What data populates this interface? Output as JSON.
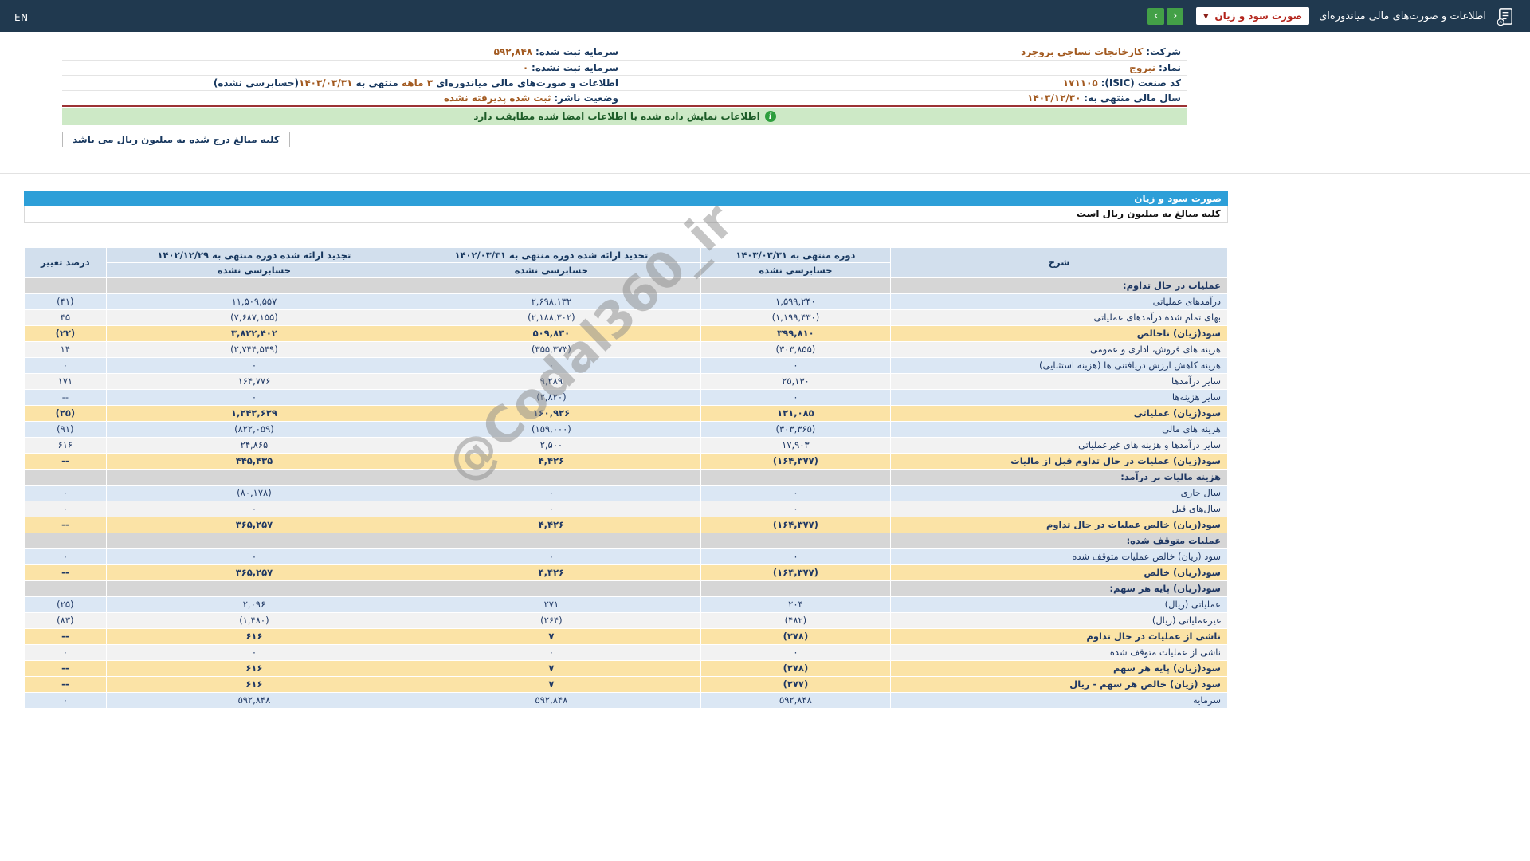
{
  "navbar": {
    "title": "اطلاعات و صورت‌های مالی میاندوره‌ای",
    "dropdown_value": "صورت سود و زیان",
    "dropdown_caret": "▼",
    "prev_icon": "‹",
    "next_icon": "›",
    "lang_toggle": "EN",
    "bg_color": "#20394f",
    "button_color": "#43a047"
  },
  "info": {
    "company": {
      "label": "شرکت:",
      "value": "کارخانجات نساجي بروجرد"
    },
    "symbol": {
      "label": "نماد:",
      "value": "نبروج"
    },
    "isic": {
      "label": "کد صنعت (ISIC):",
      "value": "۱۷۱۱۰۵"
    },
    "fiscal_year": {
      "label": "سال مالی منتهی به:",
      "value": "۱۴۰۳/۱۲/۳۰"
    },
    "registered_capital": {
      "label": "سرمایه ثبت شده:",
      "value": "۵۹۲,۸۴۸"
    },
    "unregistered_capital": {
      "label": "سرمایه ثبت نشده:",
      "value": "۰"
    },
    "period": {
      "prefix": "اطلاعات و صورت‌های مالی میاندوره‌ای",
      "months": " ۳ ماهه ",
      "mid": "منتهی به ",
      "date": "۱۴۰۳/۰۳/۳۱",
      "suffix": "(حسابرسی نشده)"
    },
    "publisher_status": {
      "label": "وضعیت ناشر:",
      "value": "ثبت شده پذیرفته نشده"
    }
  },
  "banner": {
    "text": "اطلاعات نمایش داده شده با اطلاعات امضا شده مطابقت دارد",
    "icon": "i"
  },
  "unit_note_box": "کلیه مبالغ درج شده به میلیون ریال می باشد",
  "watermark": "@Codal360_ir",
  "statement": {
    "title": "صورت سود و زیان",
    "unit_note": "کلیه مبالغ به میلیون ریال است",
    "accent_color": "#2d9fd8",
    "negative_color": "#e10000",
    "highlight_color": "#fbe3a6",
    "columns": {
      "description": "شرح",
      "current": {
        "title": "دوره منتهی به ۱۴۰۳/۰۳/۳۱",
        "sub": "حسابرسی نشده"
      },
      "prior": {
        "title": "تجدید ارائه شده دوره منتهی به ۱۴۰۲/۰۳/۳۱",
        "sub": "حسابرسی نشده"
      },
      "year_end": {
        "title": "تجدید ارائه شده دوره منتهی به ۱۴۰۲/۱۲/۲۹",
        "sub": "حسابرسی نشده"
      },
      "change": "درصد تغییر"
    },
    "rows": [
      {
        "type": "section",
        "bg": "section",
        "label": "عملیات در حال تداوم:"
      },
      {
        "type": "data",
        "bg": "blue",
        "label": "درآمدهای عملیاتی",
        "values": [
          "۱,۵۹۹,۲۴۰",
          "۲,۶۹۸,۱۳۲",
          "۱۱,۵۰۹,۵۵۷",
          "(۴۱)"
        ]
      },
      {
        "type": "data",
        "bg": "white",
        "label": "بهای تمام شده درآمدهای عملیاتی",
        "values": [
          "(۱,۱۹۹,۴۳۰)",
          "(۲,۱۸۸,۳۰۲)",
          "(۷,۶۸۷,۱۵۵)",
          "۴۵"
        ]
      },
      {
        "type": "data",
        "bg": "yellow",
        "label": "سود(زیان) ناخالص",
        "values": [
          "۳۹۹,۸۱۰",
          "۵۰۹,۸۳۰",
          "۳,۸۲۲,۴۰۲",
          "(۲۲)"
        ]
      },
      {
        "type": "data",
        "bg": "white",
        "label": "هزینه های فروش، اداری و عمومی",
        "values": [
          "(۳۰۳,۸۵۵)",
          "(۳۵۵,۳۷۳)",
          "(۲,۷۴۴,۵۴۹)",
          "۱۴"
        ]
      },
      {
        "type": "data",
        "bg": "blue",
        "label": "هزینه کاهش ارزش دریافتنی ها (هزینه استثنایی)",
        "values": [
          "۰",
          "۰",
          "۰",
          "۰"
        ]
      },
      {
        "type": "data",
        "bg": "white",
        "label": "سایر درآمدها",
        "values": [
          "۲۵,۱۳۰",
          "۹,۲۸۹",
          "۱۶۴,۷۷۶",
          "۱۷۱"
        ]
      },
      {
        "type": "data",
        "bg": "blue",
        "label": "سایر هزینه‌ها",
        "values": [
          "۰",
          "(۲,۸۲۰)",
          "۰",
          "--"
        ]
      },
      {
        "type": "data",
        "bg": "yellow",
        "label": "سود(زیان) عملیاتی",
        "values": [
          "۱۲۱,۰۸۵",
          "۱۶۰,۹۲۶",
          "۱,۲۴۲,۶۲۹",
          "(۲۵)"
        ]
      },
      {
        "type": "data",
        "bg": "blue",
        "label": "هزینه های مالی",
        "values": [
          "(۳۰۳,۳۶۵)",
          "(۱۵۹,۰۰۰)",
          "(۸۲۲,۰۵۹)",
          "(۹۱)"
        ]
      },
      {
        "type": "data",
        "bg": "white",
        "label": "سایر درآمدها و هزینه های غیرعملیاتی",
        "values": [
          "۱۷,۹۰۳",
          "۲,۵۰۰",
          "۲۴,۸۶۵",
          "۶۱۶"
        ]
      },
      {
        "type": "data",
        "bg": "yellow",
        "label": "سود(زیان) عملیات در حال تداوم قبل از مالیات",
        "values": [
          "(۱۶۴,۳۷۷)",
          "۴,۴۲۶",
          "۴۴۵,۴۳۵",
          "--"
        ]
      },
      {
        "type": "section",
        "bg": "section",
        "label": "هزینه مالیات بر درآمد:"
      },
      {
        "type": "data",
        "bg": "blue",
        "label": "سال جاری",
        "values": [
          "۰",
          "۰",
          "(۸۰,۱۷۸)",
          "۰"
        ]
      },
      {
        "type": "data",
        "bg": "white",
        "label": "سال‌های قبل",
        "values": [
          "۰",
          "۰",
          "۰",
          "۰"
        ]
      },
      {
        "type": "data",
        "bg": "yellow",
        "label": "سود(زیان) خالص عملیات در حال تداوم",
        "values": [
          "(۱۶۴,۳۷۷)",
          "۴,۴۲۶",
          "۳۶۵,۲۵۷",
          "--"
        ]
      },
      {
        "type": "section",
        "bg": "section",
        "label": "عملیات متوقف شده:"
      },
      {
        "type": "data",
        "bg": "blue",
        "label": "سود (زیان) خالص عملیات متوقف شده",
        "values": [
          "۰",
          "۰",
          "۰",
          "۰"
        ]
      },
      {
        "type": "data",
        "bg": "yellow",
        "label": "سود(زیان) خالص",
        "values": [
          "(۱۶۴,۳۷۷)",
          "۴,۴۲۶",
          "۳۶۵,۲۵۷",
          "--"
        ]
      },
      {
        "type": "section",
        "bg": "section",
        "label": "سود(زیان) پایه هر سهم:"
      },
      {
        "type": "data",
        "bg": "blue",
        "label": "عملیاتی (ریال)",
        "values": [
          "۲۰۴",
          "۲۷۱",
          "۲,۰۹۶",
          "(۲۵)"
        ]
      },
      {
        "type": "data",
        "bg": "white",
        "label": "غیرعملیاتی (ریال)",
        "values": [
          "(۴۸۲)",
          "(۲۶۴)",
          "(۱,۴۸۰)",
          "(۸۳)"
        ]
      },
      {
        "type": "data",
        "bg": "yellow",
        "label": "ناشی از عملیات در حال تداوم",
        "values": [
          "(۲۷۸)",
          "۷",
          "۶۱۶",
          "--"
        ]
      },
      {
        "type": "data",
        "bg": "white",
        "label": "ناشی از عملیات متوقف شده",
        "values": [
          "۰",
          "۰",
          "۰",
          "۰"
        ]
      },
      {
        "type": "data",
        "bg": "yellow",
        "label": "سود(زیان) پایه هر سهم",
        "values": [
          "(۲۷۸)",
          "۷",
          "۶۱۶",
          "--"
        ]
      },
      {
        "type": "data",
        "bg": "yellow",
        "label": "سود (زیان) خالص هر سهم - ریال",
        "values": [
          "(۲۷۷)",
          "۷",
          "۶۱۶",
          "--"
        ]
      },
      {
        "type": "data",
        "bg": "blue",
        "label": "سرمایه",
        "values": [
          "۵۹۲,۸۴۸",
          "۵۹۲,۸۴۸",
          "۵۹۲,۸۴۸",
          "۰"
        ]
      }
    ]
  }
}
